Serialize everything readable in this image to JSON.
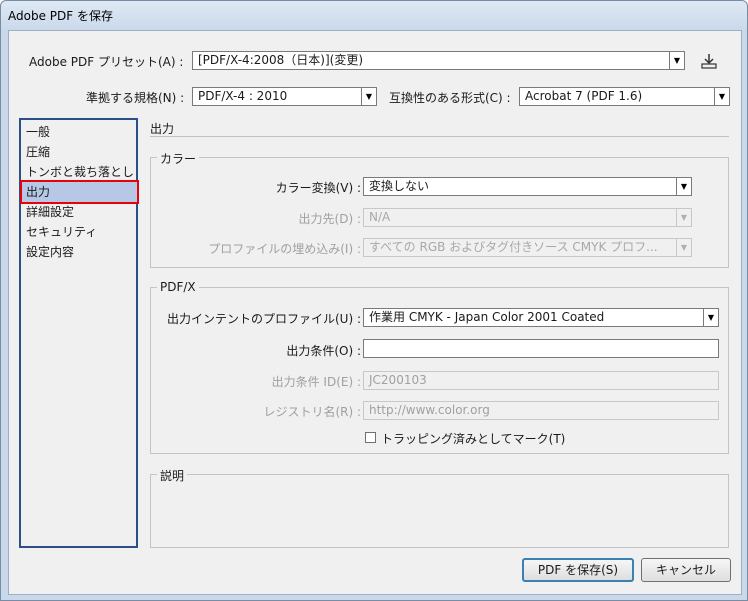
{
  "window": {
    "title": "Adobe PDF を保存"
  },
  "preset": {
    "label": "Adobe PDF プリセット(A) :",
    "value": "[PDF/X-4:2008（日本)](変更)"
  },
  "standard": {
    "label": "準拠する規格(N) :",
    "value": "PDF/X-4 : 2010"
  },
  "compat": {
    "label": "互換性のある形式(C) :",
    "value": "Acrobat 7 (PDF 1.6)"
  },
  "sidebar": {
    "items": [
      {
        "label": "一般"
      },
      {
        "label": "圧縮"
      },
      {
        "label": "トンボと裁ち落とし"
      },
      {
        "label": "出力"
      },
      {
        "label": "詳細設定"
      },
      {
        "label": "セキュリティ"
      },
      {
        "label": "設定内容"
      }
    ]
  },
  "section": {
    "title": "出力"
  },
  "color": {
    "group_title": "カラー",
    "conversion_label": "カラー変換(V) :",
    "conversion_value": "変換しない",
    "destination_label": "出力先(D) :",
    "destination_value": "N/A",
    "profile_label": "プロファイルの埋め込み(I) :",
    "profile_value": "すべての RGB およびタグ付きソース CMYK プロフ..."
  },
  "pdfx": {
    "group_title": "PDF/X",
    "intent_label": "出力インテントのプロファイル(U) :",
    "intent_value": "作業用 CMYK - Japan Color 2001 Coated",
    "condition_label": "出力条件(O) :",
    "condition_value": "",
    "condition_id_label": "出力条件 ID(E) :",
    "condition_id_value": "JC200103",
    "registry_label": "レジストリ名(R) :",
    "registry_value": "http://www.color.org",
    "trapped_label": "トラッピング済みとしてマーク(T)"
  },
  "description": {
    "group_title": "説明"
  },
  "buttons": {
    "save": "PDF を保存(S)",
    "cancel": "キャンセル"
  }
}
